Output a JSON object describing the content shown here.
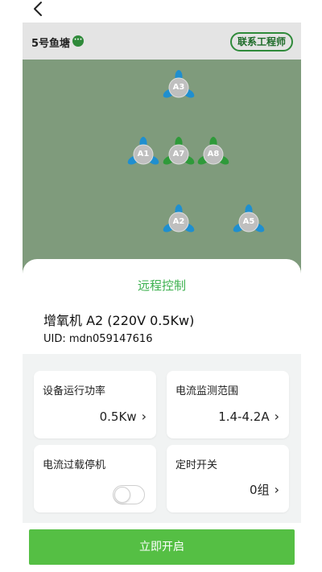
{
  "nav": {
    "back_icon": "chevron-left-icon"
  },
  "pond": {
    "name": "5号鱼塘",
    "menu_dot": "···",
    "contact_label": "联系工程师",
    "background_color": "#7f9b7c",
    "aerators": [
      {
        "id": "a3",
        "label": "A3",
        "color": "#1f8fcf"
      },
      {
        "id": "a1",
        "label": "A1",
        "color": "#1f8fcf"
      },
      {
        "id": "a7",
        "label": "A7",
        "color": "#2f9a3a"
      },
      {
        "id": "a8",
        "label": "A8",
        "color": "#2f9a3a"
      },
      {
        "id": "a2",
        "label": "A2",
        "color": "#1f8fcf"
      },
      {
        "id": "a5",
        "label": "A5",
        "color": "#1f8fcf"
      }
    ]
  },
  "sheet": {
    "title": "远程控制",
    "device_name": "增氧机 A2 (220V 0.5Kw)",
    "device_uid": "UID: mdn059147616"
  },
  "cards": {
    "power": {
      "label": "设备运行功率",
      "value": "0.5Kw"
    },
    "current_range": {
      "label": "电流监测范围",
      "value": "1.4-4.2A"
    },
    "overload_stop": {
      "label": "电流过载停机",
      "enabled": false
    },
    "timer": {
      "label": "定时开关",
      "value": "0组"
    }
  },
  "actions": {
    "start_label": "立即开启"
  },
  "colors": {
    "accent": "#3bb04d",
    "button": "#55bf44"
  }
}
